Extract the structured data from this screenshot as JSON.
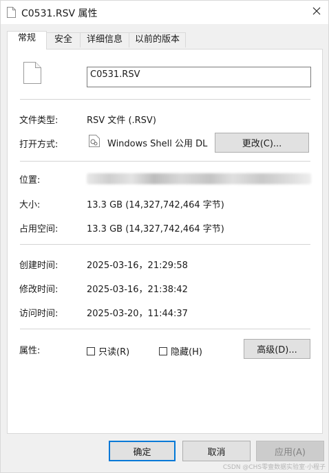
{
  "window": {
    "title": "C0531.RSV 属性",
    "close_icon": "close-icon"
  },
  "tabs": [
    {
      "label": "常规",
      "active": true
    },
    {
      "label": "安全",
      "active": false
    },
    {
      "label": "详细信息",
      "active": false
    },
    {
      "label": "以前的版本",
      "active": false
    }
  ],
  "general": {
    "file_name": "C0531.RSV",
    "file_type_label": "文件类型:",
    "file_type_value": "RSV 文件 (.RSV)",
    "opens_with_label": "打开方式:",
    "opens_with_value": "Windows Shell 公用 DL",
    "change_button": "更改(C)...",
    "location_label": "位置:",
    "size_label": "大小:",
    "size_value": "13.3 GB (14,327,742,464 字节)",
    "size_on_disk_label": "占用空间:",
    "size_on_disk_value": "13.3 GB (14,327,742,464 字节)",
    "created_label": "创建时间:",
    "created_value": "2025-03-16，21:29:58",
    "modified_label": "修改时间:",
    "modified_value": "2025-03-16，21:38:42",
    "accessed_label": "访问时间:",
    "accessed_value": "2025-03-20，11:44:37",
    "attributes_label": "属性:",
    "readonly_label": "只读(R)",
    "readonly_checked": false,
    "hidden_label": "隐藏(H)",
    "hidden_checked": false,
    "advanced_button": "高级(D)..."
  },
  "footer": {
    "ok_button": "确定",
    "cancel_button": "取消",
    "apply_button": "应用(A)",
    "apply_enabled": false
  },
  "watermark": "CSDN @CHS零壹数据实验室·小程子",
  "colors": {
    "accent": "#0078d7",
    "disabled_text": "#838383"
  }
}
